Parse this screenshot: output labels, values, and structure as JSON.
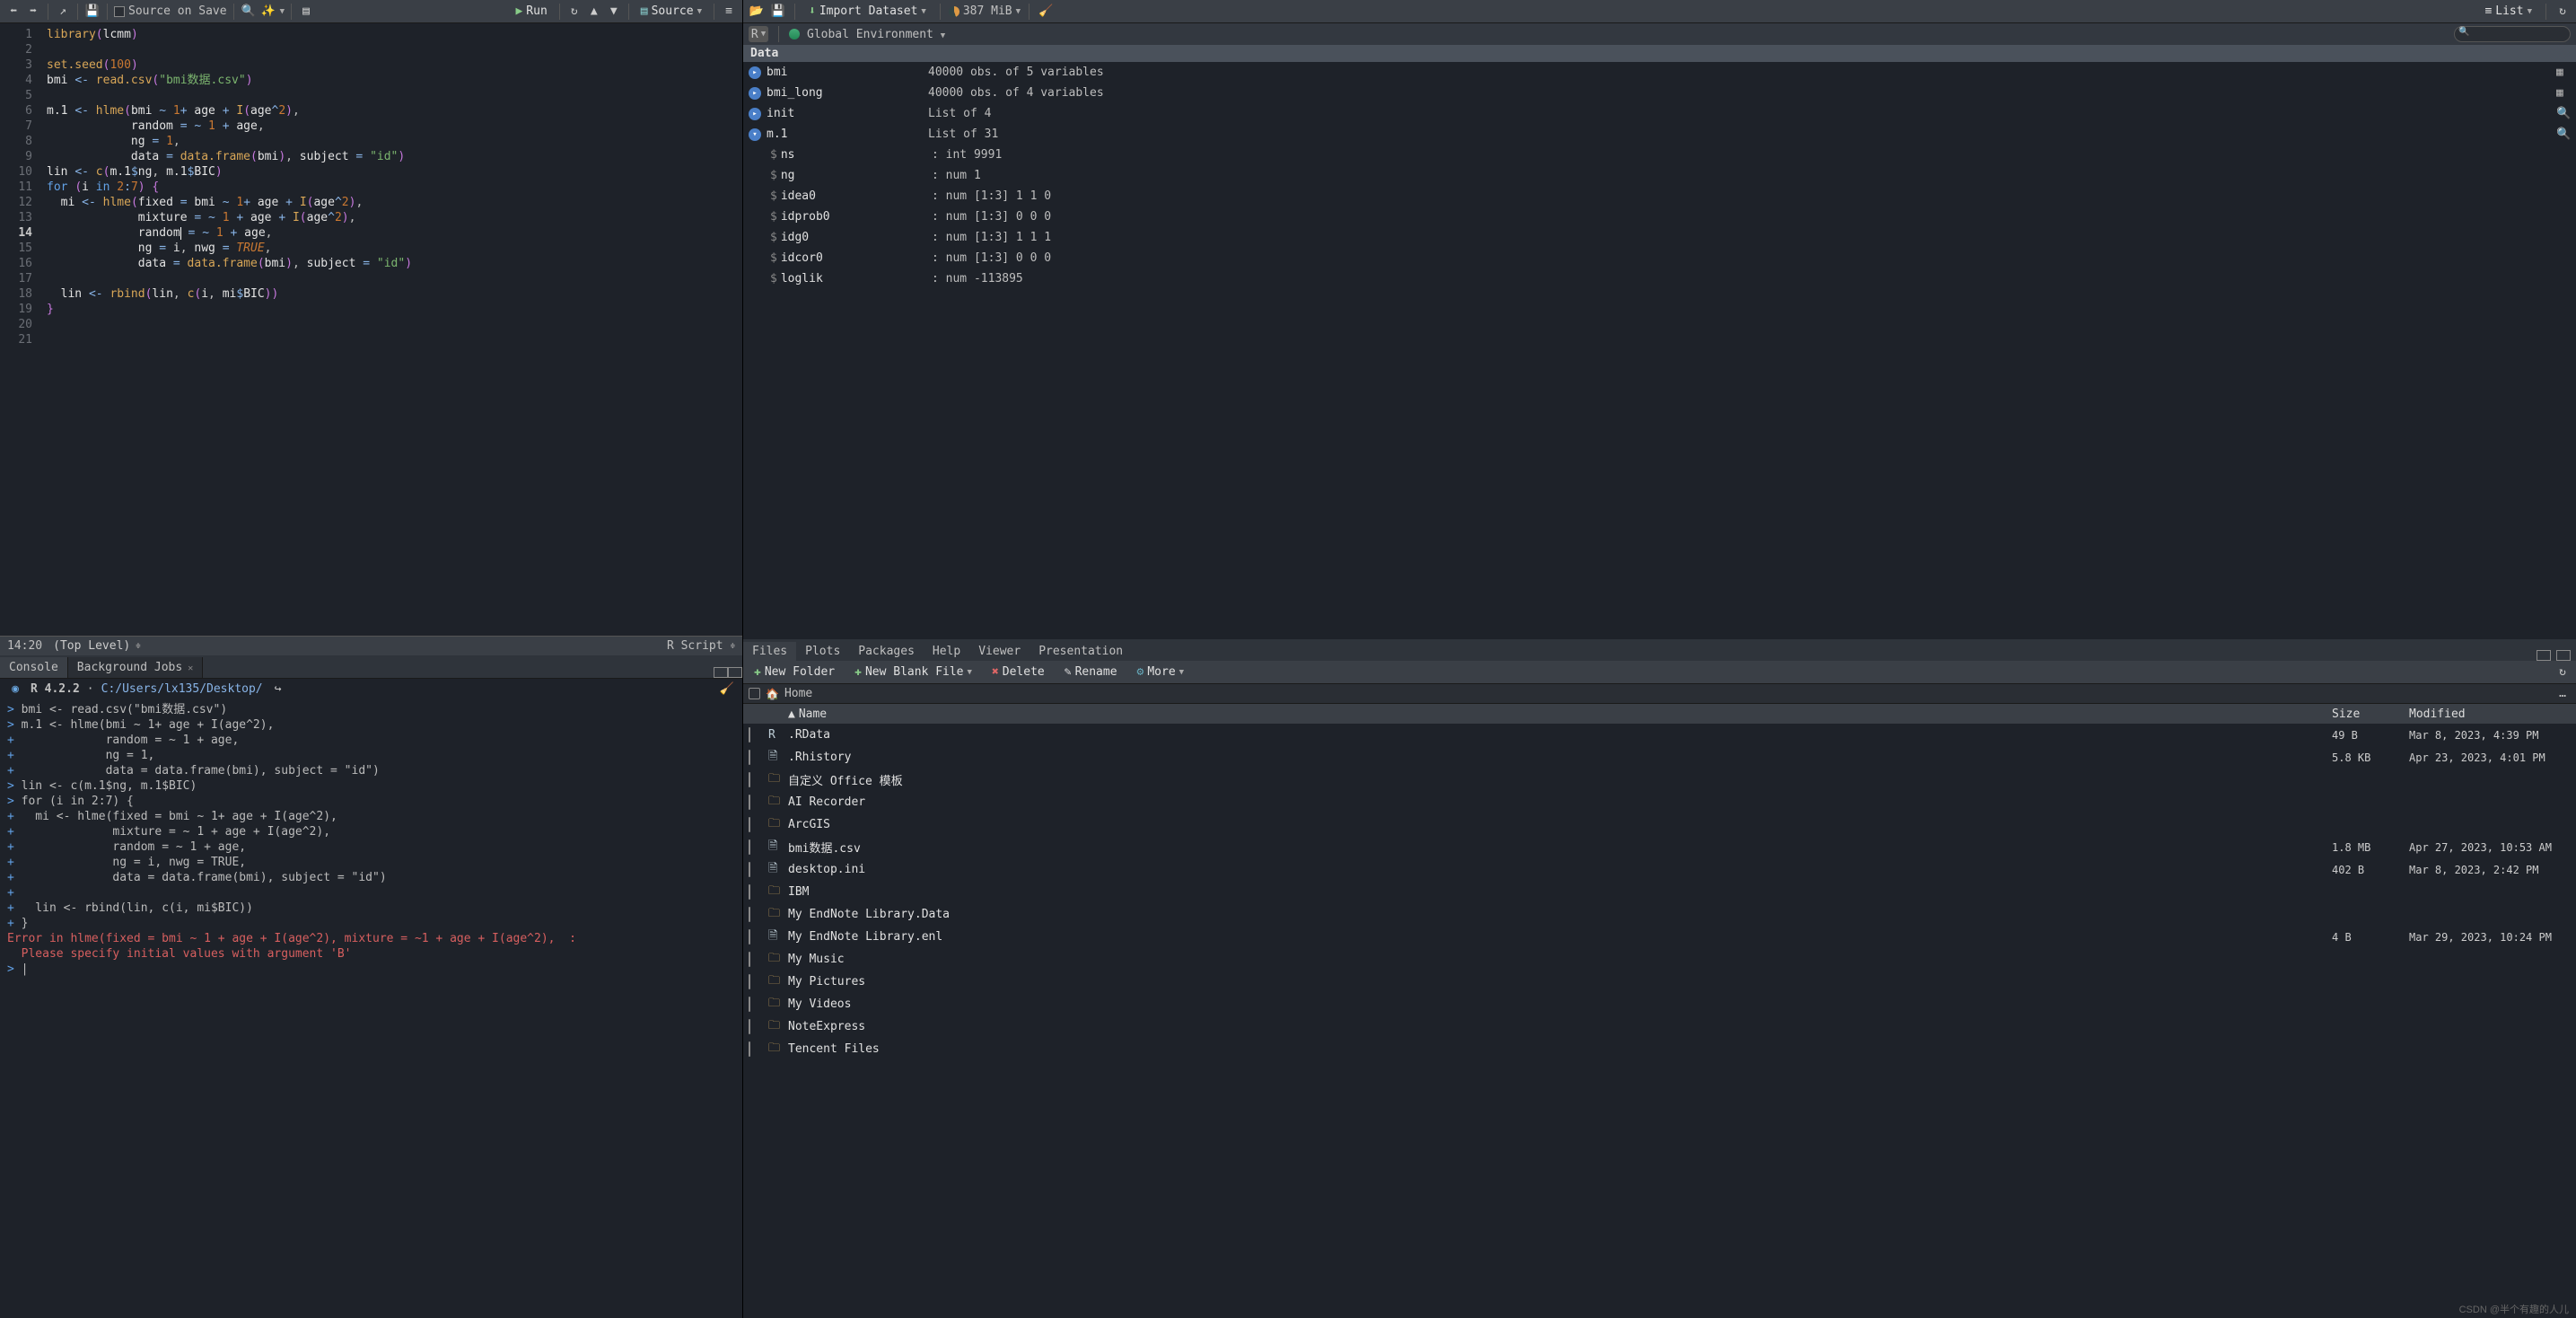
{
  "source_toolbar": {
    "source_on_save": "Source on Save",
    "run": "Run",
    "source": "Source"
  },
  "code_lines": [
    "library(lcmm)",
    "",
    "set.seed(100)",
    "bmi <- read.csv(\"bmi数据.csv\")",
    "",
    "m.1 <- hlme(bmi ~ 1+ age + I(age^2),",
    "            random = ~ 1 + age,",
    "            ng = 1,",
    "            data = data.frame(bmi), subject = \"id\")",
    "lin <- c(m.1$ng, m.1$BIC)",
    "for (i in 2:7) {",
    "  mi <- hlme(fixed = bmi ~ 1+ age + I(age^2),",
    "             mixture = ~ 1 + age + I(age^2),",
    "             random = ~ 1 + age,",
    "             ng = i, nwg = TRUE,",
    "             data = data.frame(bmi), subject = \"id\")",
    "",
    "  lin <- rbind(lin, c(i, mi$BIC))",
    "}",
    "",
    ""
  ],
  "status": {
    "cursor": "14:20",
    "scope": "(Top Level)",
    "lang": "R Script"
  },
  "console_tabs": {
    "console": "Console",
    "bgjobs": "Background Jobs"
  },
  "console_header": {
    "r_version": "R 4.2.2",
    "path": "C:/Users/lx135/Desktop/"
  },
  "console_lines": [
    {
      "type": "out",
      "text": "> bmi <- read.csv(\"bmi数据.csv\")"
    },
    {
      "type": "out",
      "text": "> m.1 <- hlme(bmi ~ 1+ age + I(age^2),"
    },
    {
      "type": "out",
      "text": "+             random = ~ 1 + age,"
    },
    {
      "type": "out",
      "text": "+             ng = 1,"
    },
    {
      "type": "out",
      "text": "+             data = data.frame(bmi), subject = \"id\")"
    },
    {
      "type": "out",
      "text": "> lin <- c(m.1$ng, m.1$BIC)"
    },
    {
      "type": "out",
      "text": "> for (i in 2:7) {"
    },
    {
      "type": "out",
      "text": "+   mi <- hlme(fixed = bmi ~ 1+ age + I(age^2),"
    },
    {
      "type": "out",
      "text": "+              mixture = ~ 1 + age + I(age^2),"
    },
    {
      "type": "out",
      "text": "+              random = ~ 1 + age,"
    },
    {
      "type": "out",
      "text": "+              ng = i, nwg = TRUE,"
    },
    {
      "type": "out",
      "text": "+              data = data.frame(bmi), subject = \"id\")"
    },
    {
      "type": "out",
      "text": "+ "
    },
    {
      "type": "out",
      "text": "+   lin <- rbind(lin, c(i, mi$BIC))"
    },
    {
      "type": "out",
      "text": "+ }"
    },
    {
      "type": "err",
      "text": "Error in hlme(fixed = bmi ~ 1 + age + I(age^2), mixture = ~1 + age + I(age^2),  : "
    },
    {
      "type": "err",
      "text": "  Please specify initial values with argument 'B'"
    },
    {
      "type": "out",
      "text": "> |"
    }
  ],
  "env_toolbar": {
    "import": "Import Dataset",
    "memory": "387 MiB",
    "list": "List"
  },
  "env_scope": {
    "r": "R",
    "global": "Global Environment"
  },
  "env_section": "Data",
  "env_rows": [
    {
      "name": "bmi",
      "value": "40000 obs. of 5 variables",
      "action": "table"
    },
    {
      "name": "bmi_long",
      "value": "40000 obs. of 4 variables",
      "action": "table"
    },
    {
      "name": "init",
      "value": "List of  4",
      "action": "zoom"
    },
    {
      "name": "m.1",
      "value": "List of  31",
      "action": "zoom",
      "expanded": true
    }
  ],
  "env_children": [
    {
      "key": "ns",
      "val": ": int 9991"
    },
    {
      "key": "ng",
      "val": ": num 1"
    },
    {
      "key": "idea0",
      "val": ": num [1:3] 1 1 0"
    },
    {
      "key": "idprob0",
      "val": ": num [1:3] 0 0 0"
    },
    {
      "key": "idg0",
      "val": ": num [1:3] 1 1 1"
    },
    {
      "key": "idcor0",
      "val": ": num [1:3] 0 0 0"
    },
    {
      "key": "loglik",
      "val": ": num -113895"
    }
  ],
  "bottom_tabs": [
    "Files",
    "Plots",
    "Packages",
    "Help",
    "Viewer",
    "Presentation"
  ],
  "files_toolbar": {
    "new_folder": "New Folder",
    "new_file": "New Blank File",
    "delete": "Delete",
    "rename": "Rename",
    "more": "More"
  },
  "breadcrumb": "Home",
  "file_columns": {
    "name": "Name",
    "size": "Size",
    "modified": "Modified"
  },
  "files": [
    {
      "icon": "r",
      "name": ".RData",
      "size": "49 B",
      "modified": "Mar 8, 2023, 4:39 PM"
    },
    {
      "icon": "file",
      "name": ".Rhistory",
      "size": "5.8 KB",
      "modified": "Apr 23, 2023, 4:01 PM"
    },
    {
      "icon": "folder",
      "name": "自定义 Office 模板"
    },
    {
      "icon": "folder",
      "name": "AI Recorder"
    },
    {
      "icon": "folder",
      "name": "ArcGIS"
    },
    {
      "icon": "file",
      "name": "bmi数据.csv",
      "size": "1.8 MB",
      "modified": "Apr 27, 2023, 10:53 AM"
    },
    {
      "icon": "file",
      "name": "desktop.ini",
      "size": "402 B",
      "modified": "Mar 8, 2023, 2:42 PM"
    },
    {
      "icon": "folder",
      "name": "IBM"
    },
    {
      "icon": "folder",
      "name": "My EndNote Library.Data"
    },
    {
      "icon": "file",
      "name": "My EndNote Library.enl",
      "size": "4 B",
      "modified": "Mar 29, 2023, 10:24 PM"
    },
    {
      "icon": "folder",
      "name": "My Music"
    },
    {
      "icon": "folder",
      "name": "My Pictures"
    },
    {
      "icon": "folder",
      "name": "My Videos"
    },
    {
      "icon": "folder",
      "name": "NoteExpress"
    },
    {
      "icon": "folder",
      "name": "Tencent Files"
    }
  ],
  "watermark": "CSDN @半个有趣的人儿"
}
